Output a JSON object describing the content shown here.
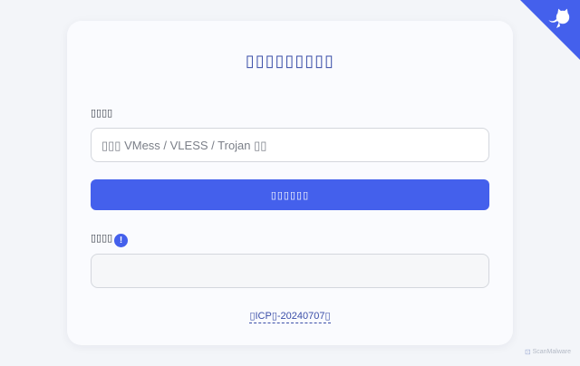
{
  "page": {
    "title": "▯▯▯▯▯▯▯▯▯",
    "accent_color": "#4460ec"
  },
  "form": {
    "input_label": "▯▯▯▯",
    "input_placeholder": "▯▯▯ VMess / VLESS / Trojan ▯▯",
    "input_value": "",
    "convert_button_label": "▯▯▯▯▯▯",
    "output_label": "▯▯▯▯",
    "output_value": "",
    "info_badge": "!"
  },
  "footer": {
    "icp_link": "▯ICP▯-20240707▯"
  },
  "corner": {
    "icon": "github-octocat-icon",
    "color": "#4460ec"
  },
  "watermark": {
    "text": "ScanMalware"
  }
}
